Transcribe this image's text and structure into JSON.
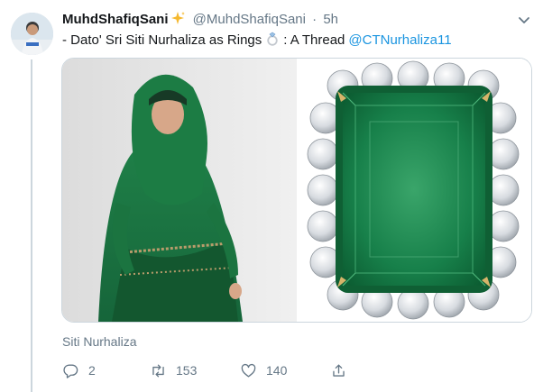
{
  "tweet": {
    "display_name": "MuhdShafiqSani",
    "name_emoji": "sparkles-icon",
    "handle": "@MuhdShafiqSani",
    "separator": "·",
    "time": "5h",
    "text_before": "- Dato' Sri Siti Nurhaliza as Rings",
    "text_emoji": "ring-icon",
    "text_after": ": A Thread",
    "mention": "@CTNurhaliza11",
    "caption": "Siti Nurhaliza"
  },
  "actions": {
    "reply_count": "2",
    "retweet_count": "153",
    "like_count": "140"
  },
  "colors": {
    "link": "#1b95e0",
    "muted": "#657786",
    "emerald": "#1f8a4c",
    "dress": "#1d7a45"
  },
  "media": {
    "left_image": "woman in green hijab and dress",
    "right_image": "emerald ring with diamond halo"
  }
}
